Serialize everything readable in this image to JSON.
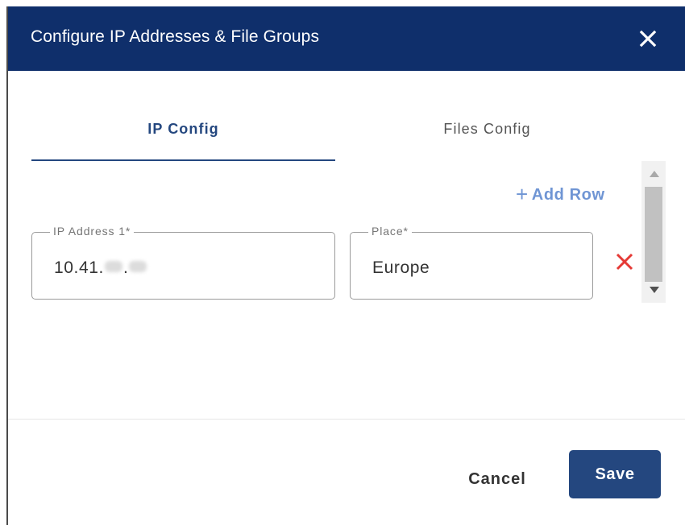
{
  "dialog": {
    "title": "Configure IP Addresses & File Groups",
    "close_icon": "close-icon"
  },
  "tabs": [
    {
      "label": "IP Config",
      "active": true
    },
    {
      "label": "Files Config",
      "active": false
    }
  ],
  "add_row": {
    "label": "Add Row",
    "icon": "plus-icon"
  },
  "rows": [
    {
      "ip_label": "IP Address 1*",
      "ip_value_prefix": "10.41.",
      "ip_value_sep": ".",
      "place_label": "Place*",
      "place_value": "Europe",
      "remove_icon": "remove-icon"
    }
  ],
  "footer": {
    "cancel_label": "Cancel",
    "save_label": "Save"
  },
  "colors": {
    "header_bg": "#0f2f6b",
    "accent": "#24477f",
    "add_row": "#6f95d4",
    "remove": "#e53935"
  }
}
